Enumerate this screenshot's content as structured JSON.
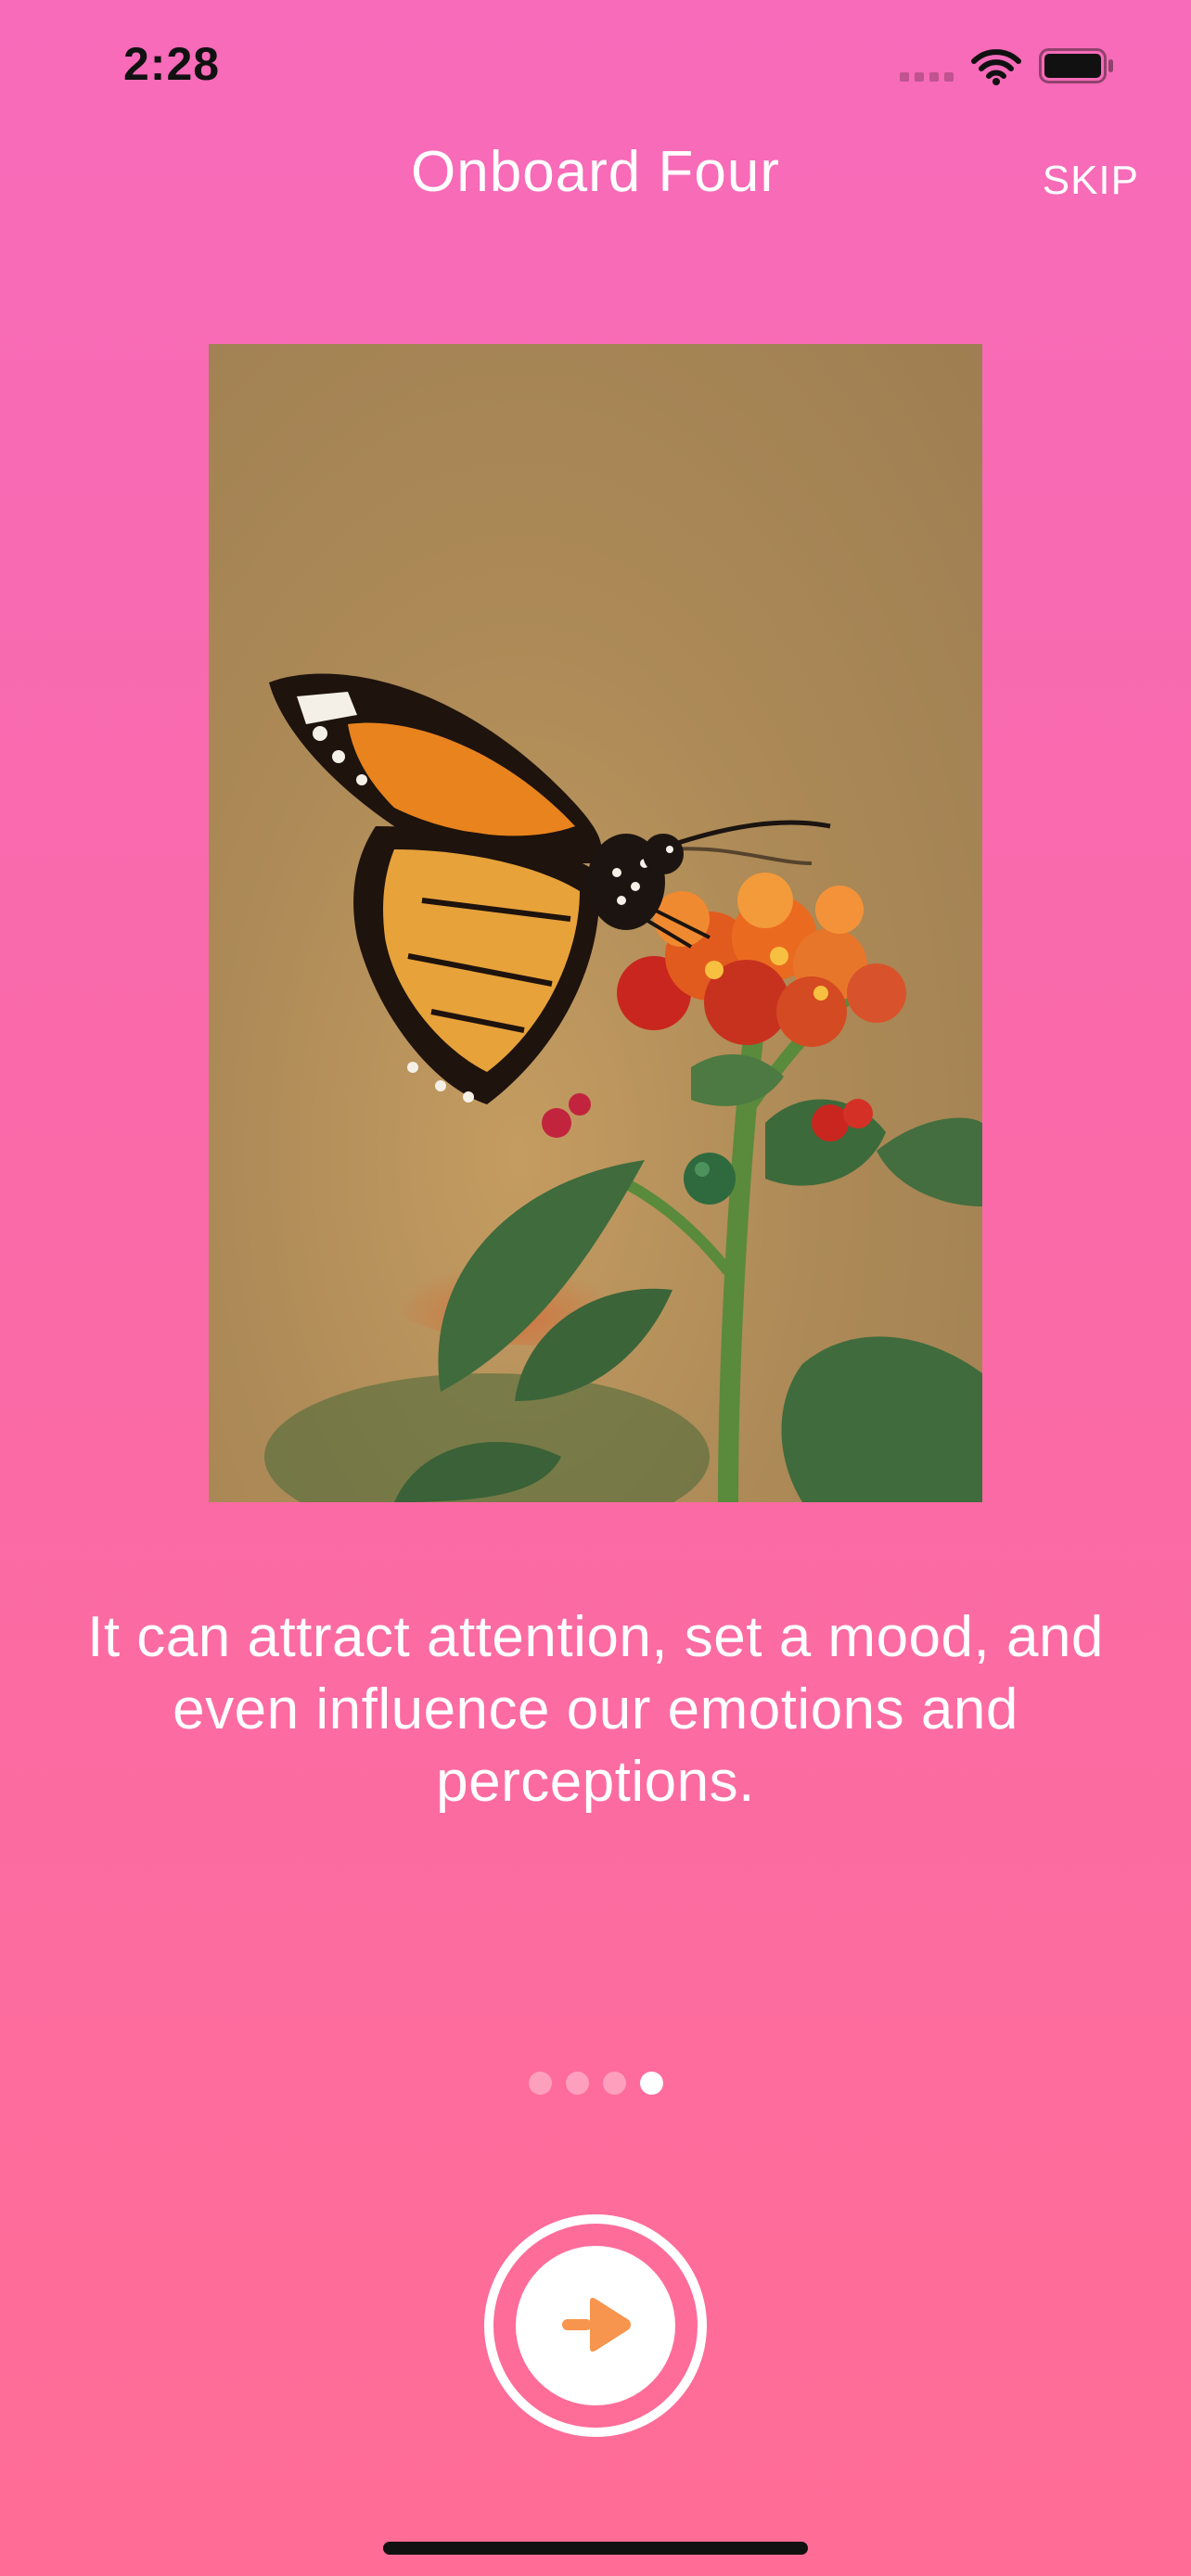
{
  "status_bar": {
    "time": "2:28"
  },
  "nav": {
    "title": "Onboard Four",
    "skip_label": "SKIP"
  },
  "onboarding": {
    "description": "It can attract attention, set a mood, and even influence our emotions and perceptions.",
    "page_count": 4,
    "current_page": 4
  },
  "colors": {
    "background_top": "#f76bba",
    "background_bottom": "#ff6d96",
    "arrow_orange": "#f7944d"
  },
  "icons": {
    "next": "arrow-right-icon",
    "wifi": "wifi-icon",
    "battery": "battery-icon",
    "signal": "cellular-signal-icon"
  }
}
